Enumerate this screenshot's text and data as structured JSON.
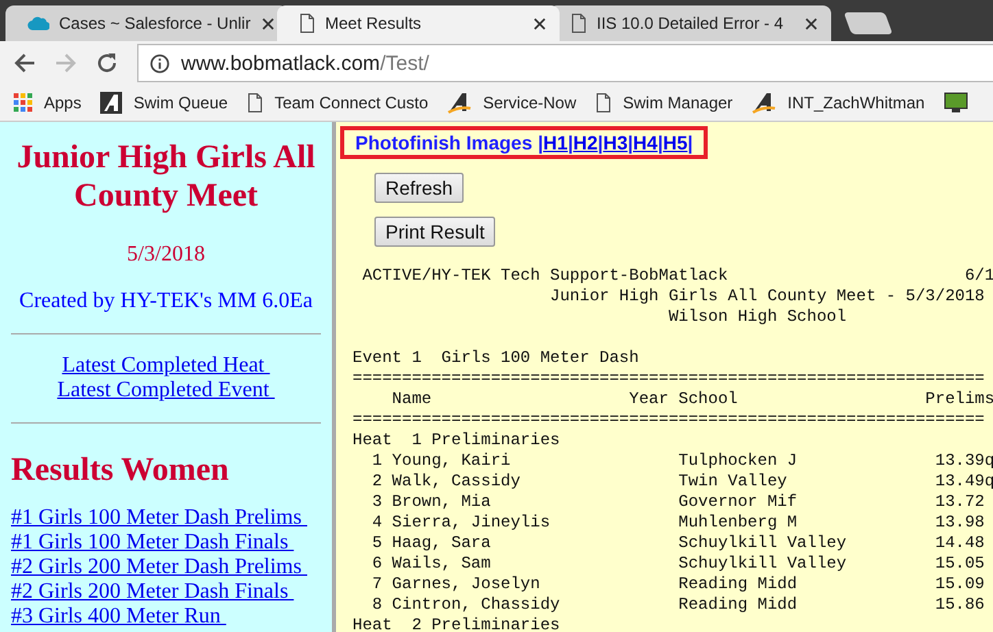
{
  "browser": {
    "tabs": [
      {
        "title": "Cases ~ Salesforce - Unlir",
        "kind": "cloud",
        "selected": false
      },
      {
        "title": "Meet Results",
        "kind": "page",
        "selected": true
      },
      {
        "title": "IIS 10.0 Detailed Error - 4",
        "kind": "page",
        "selected": false
      }
    ],
    "address": {
      "host": "www.bobmatlack.com",
      "path": "/Test/"
    },
    "bookmarks": [
      {
        "label": "Apps",
        "kind": "apps"
      },
      {
        "label": "Swim Queue",
        "kind": "logo"
      },
      {
        "label": "Team Connect Custo",
        "kind": "page"
      },
      {
        "label": "Service-Now",
        "kind": "logo2"
      },
      {
        "label": "Swim Manager",
        "kind": "page"
      },
      {
        "label": "INT_ZachWhitman",
        "kind": "logo2"
      },
      {
        "kind": "monitor"
      }
    ]
  },
  "sidebar": {
    "title": "Junior High Girls All County Meet",
    "date": "5/3/2018",
    "created_by": "Created by HY-TEK's MM 6.0Ea",
    "latest_links": [
      "Latest Completed Heat ",
      "Latest Completed Event "
    ],
    "section_title": "Results Women",
    "event_links": [
      "#1 Girls 100 Meter Dash Prelims ",
      "#1 Girls 100 Meter Dash Finals ",
      "#2 Girls 200 Meter Dash Prelims ",
      "#2 Girls 200 Meter Dash Finals ",
      "#3 Girls 400 Meter Run "
    ]
  },
  "main": {
    "photofinish": [
      {
        "text": "Photofinish Images",
        "kind": "label"
      },
      {
        "text": "|",
        "kind": "sep"
      },
      {
        "text": "H1",
        "kind": "link"
      },
      {
        "text": "|",
        "kind": "sep"
      },
      {
        "text": "H2",
        "kind": "link"
      },
      {
        "text": "|",
        "kind": "sep"
      },
      {
        "text": "H3",
        "kind": "link"
      },
      {
        "text": "|",
        "kind": "sep"
      },
      {
        "text": "H4",
        "kind": "link"
      },
      {
        "text": "|",
        "kind": "sep"
      },
      {
        "text": "H5",
        "kind": "link"
      },
      {
        "text": "|",
        "kind": "sep"
      }
    ],
    "buttons": [
      "Refresh",
      "Print Result"
    ],
    "header_lines": [
      " ACTIVE/HY-TEK Tech Support-BobMatlack                        6/1",
      "                    Junior High Girls All County Meet - 5/3/2018",
      "                                Wilson High School"
    ],
    "results_lines": [
      "Event 1  Girls 100 Meter Dash",
      "================================================================",
      "    Name                    Year School                   Prelims",
      "================================================================",
      "Heat  1 Preliminaries",
      "  1 Young, Kairi                 Tulphocken J              13.39q",
      "  2 Walk, Cassidy                Twin Valley               13.49q",
      "  3 Brown, Mia                   Governor Mif              13.72",
      "  4 Sierra, Jineylis             Muhlenberg M              13.98",
      "  5 Haag, Sara                   Schuylkill Valley         14.48",
      "  6 Wails, Sam                   Schuylkill Valley         15.05",
      "  7 Garnes, Joselyn              Reading Midd              15.09",
      "  8 Cintron, Chassidy            Reading Midd              15.86",
      "Heat  2 Preliminaries"
    ]
  }
}
